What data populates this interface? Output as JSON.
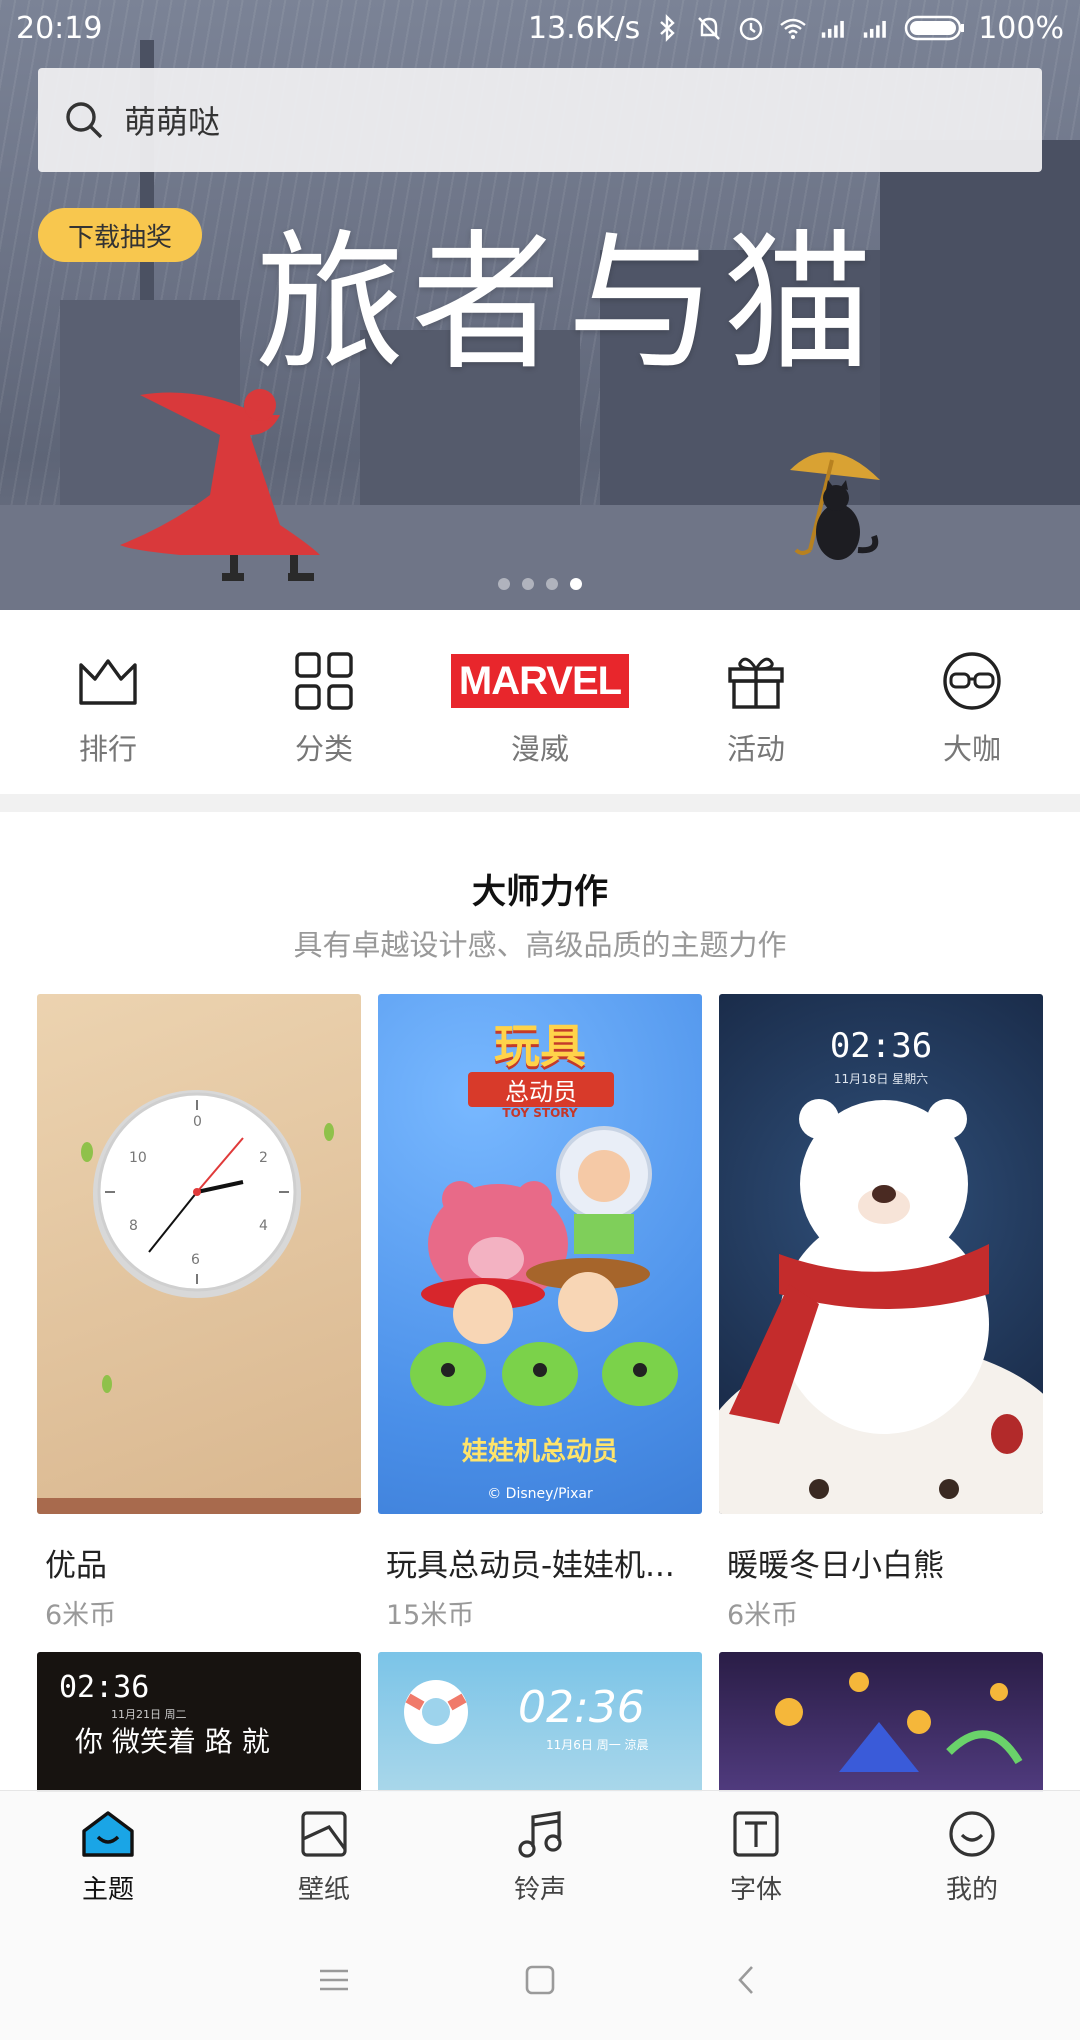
{
  "status_bar": {
    "time": "20:19",
    "network_speed": "13.6K/s",
    "battery": "100%",
    "icons": [
      "bluetooth-icon",
      "mute-bell-icon",
      "alarm-icon",
      "wifi-icon",
      "signal-icon",
      "signal-icon",
      "battery-icon"
    ]
  },
  "search": {
    "placeholder": "萌萌哒"
  },
  "banner": {
    "title": "旅者与猫",
    "promo_label": "下载抽奖",
    "page_count": 4,
    "active_page": 4
  },
  "quick_nav": [
    {
      "label": "排行",
      "icon": "crown-icon"
    },
    {
      "label": "分类",
      "icon": "grid-icon"
    },
    {
      "label": "漫威",
      "icon": "marvel-logo",
      "logo_text": "MARVEL"
    },
    {
      "label": "活动",
      "icon": "gift-icon"
    },
    {
      "label": "大咖",
      "icon": "glasses-icon"
    }
  ],
  "section": {
    "title": "大师力作",
    "subtitle": "具有卓越设计感、高级品质的主题力作"
  },
  "themes": [
    {
      "name": "优品",
      "price": "6米币"
    },
    {
      "name": "玩具总动员-娃娃机...",
      "price": "15米币",
      "art": {
        "title": "玩具",
        "subtitle": "总动员",
        "tagline": "TOY STORY",
        "bottom_text": "娃娃机总动员",
        "copyright": "© Disney/Pixar"
      }
    },
    {
      "name": "暖暖冬日小白熊",
      "price": "6米币",
      "art": {
        "time": "02:36",
        "date": "11月18日 星期六"
      }
    }
  ],
  "themes_row2": [
    {
      "time": "02:36",
      "date": "11月21日 周二",
      "text": "你 微笑着 路 就"
    },
    {
      "time": "02:36",
      "date": "11月6日 周一 涼晨"
    },
    {}
  ],
  "tab_bar": [
    {
      "label": "主题",
      "icon": "home-theme-icon",
      "active": true
    },
    {
      "label": "壁纸",
      "icon": "wallpaper-icon",
      "active": false
    },
    {
      "label": "铃声",
      "icon": "music-note-icon",
      "active": false
    },
    {
      "label": "字体",
      "icon": "font-icon",
      "active": false
    },
    {
      "label": "我的",
      "icon": "smile-icon",
      "active": false
    }
  ],
  "colors": {
    "accent": "#1aa5e6",
    "promo_badge": "#f8c74e",
    "marvel_red": "#e8262c"
  }
}
